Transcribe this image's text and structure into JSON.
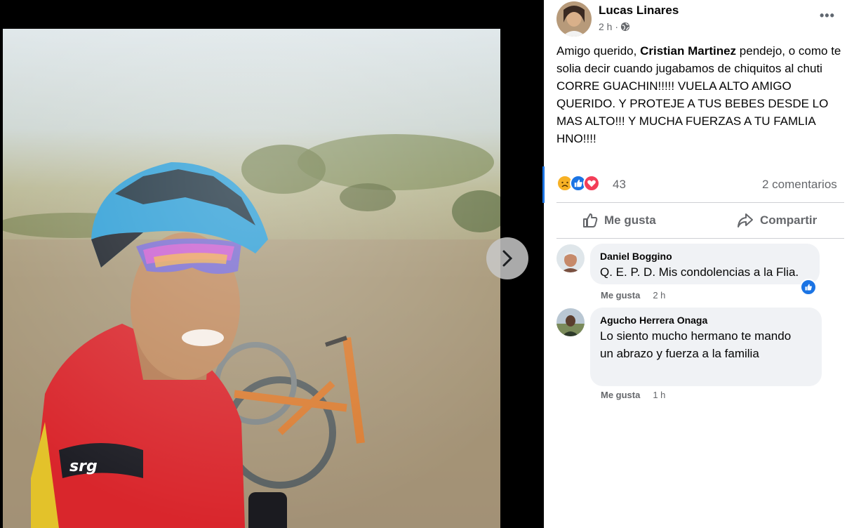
{
  "post": {
    "author": "Lucas Linares",
    "time": "2 h ·",
    "text_before": "Amigo querido, ",
    "mention": "Cristian Martinez",
    "text_after": " pendejo, o como te solia decir cuando jugabamos de chiquitos al chuti CORRE GUACHIN!!!!! VUELA ALTO AMIGO QUERIDO. Y PROTEJE A TUS BEBES DESDE LO MAS ALTO!!! Y MUCHA FUERZAS A TU FAMLIA HNO!!!!"
  },
  "icons": {
    "privacy": "globe-icon",
    "menu": "more-options-icon",
    "next": "chevron-right-icon",
    "reactions": [
      "sad-reaction-icon",
      "like-reaction-icon",
      "love-reaction-icon"
    ]
  },
  "colors": {
    "accent": "#1b74e4",
    "like": "#1b74e4",
    "love": "#f33e58",
    "sad": "#f7b125",
    "muted": "#65676b",
    "bubble": "#f0f2f5"
  },
  "stats": {
    "reaction_count": "43",
    "comments": "2 comentarios"
  },
  "actions": {
    "like": "Me gusta",
    "share": "Compartir"
  },
  "comments": [
    {
      "name": "Daniel Boggino",
      "text": "Q. E. P. D. Mis condolencias a la Flia.",
      "like": "Me gusta",
      "time": "2 h"
    },
    {
      "name": "Agucho Herrera Onaga",
      "text": "Lo siento mucho hermano te mando un abrazo y fuerza a la familia",
      "like": "Me gusta",
      "time": "1 h"
    }
  ]
}
